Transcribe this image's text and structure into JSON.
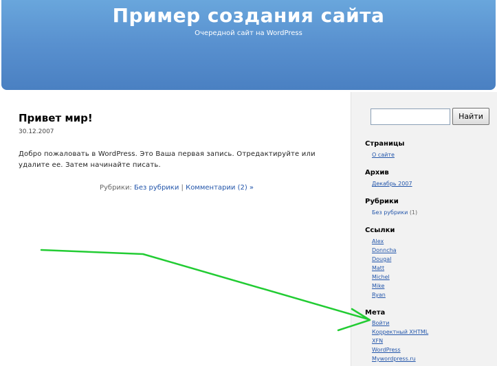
{
  "header": {
    "title": "Пример создания сайта",
    "description": "Очередной сайт на WordPress"
  },
  "post": {
    "title": "Привет мир!",
    "date": "30.12.2007",
    "body": "Добро пожаловать в WordPress. Это Ваша первая запись. Отредактируйте или удалите ее. Затем начинайте писать.",
    "categories_label": "Рубрики:",
    "category": "Без рубрики",
    "separator": "|",
    "comments": "Комментарии (2) »"
  },
  "sidebar": {
    "search_button": "Найти",
    "pages_heading": "Страницы",
    "pages": [
      "О сайте"
    ],
    "archive_heading": "Архив",
    "archive": [
      "Декабрь 2007"
    ],
    "categories_heading": "Рубрики",
    "categories": [
      {
        "label": "Без рубрики",
        "count": "(1)"
      }
    ],
    "links_heading": "Ссылки",
    "links": [
      "Alex",
      "Donncha",
      "Dougal",
      "Matt",
      "Michel",
      "Mike",
      "Ryan"
    ],
    "meta_heading": "Мета",
    "meta": [
      "Войти",
      "Корректный XHTML",
      "XFN",
      "WordPress",
      "Mywordpress.ru"
    ]
  },
  "colors": {
    "header_blue": "#5890cf",
    "link": "#2255aa",
    "annotation_arrow": "#22cc33"
  }
}
